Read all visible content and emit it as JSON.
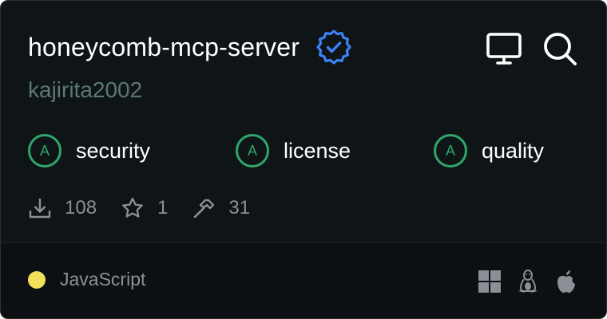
{
  "server": {
    "name": "honeycomb-mcp-server",
    "owner": "kajirita2002",
    "verified_icon": "verified-badge-icon"
  },
  "header_actions": [
    {
      "icon": "monitor-icon"
    },
    {
      "icon": "search-icon"
    }
  ],
  "badges": [
    {
      "grade": "A",
      "label": "security"
    },
    {
      "grade": "A",
      "label": "license"
    },
    {
      "grade": "A",
      "label": "quality"
    }
  ],
  "stats": {
    "downloads": "108",
    "stars": "1",
    "tools": "31"
  },
  "footer": {
    "language": "JavaScript",
    "language_color": "#f1e05a",
    "platforms": [
      "windows-icon",
      "linux-icon",
      "apple-icon"
    ]
  },
  "colors": {
    "background": "#0f1417",
    "grade_green": "#2ea56a",
    "verified_blue": "#3b82f6",
    "owner_text": "#5b7971",
    "muted_text": "#8a9096"
  }
}
